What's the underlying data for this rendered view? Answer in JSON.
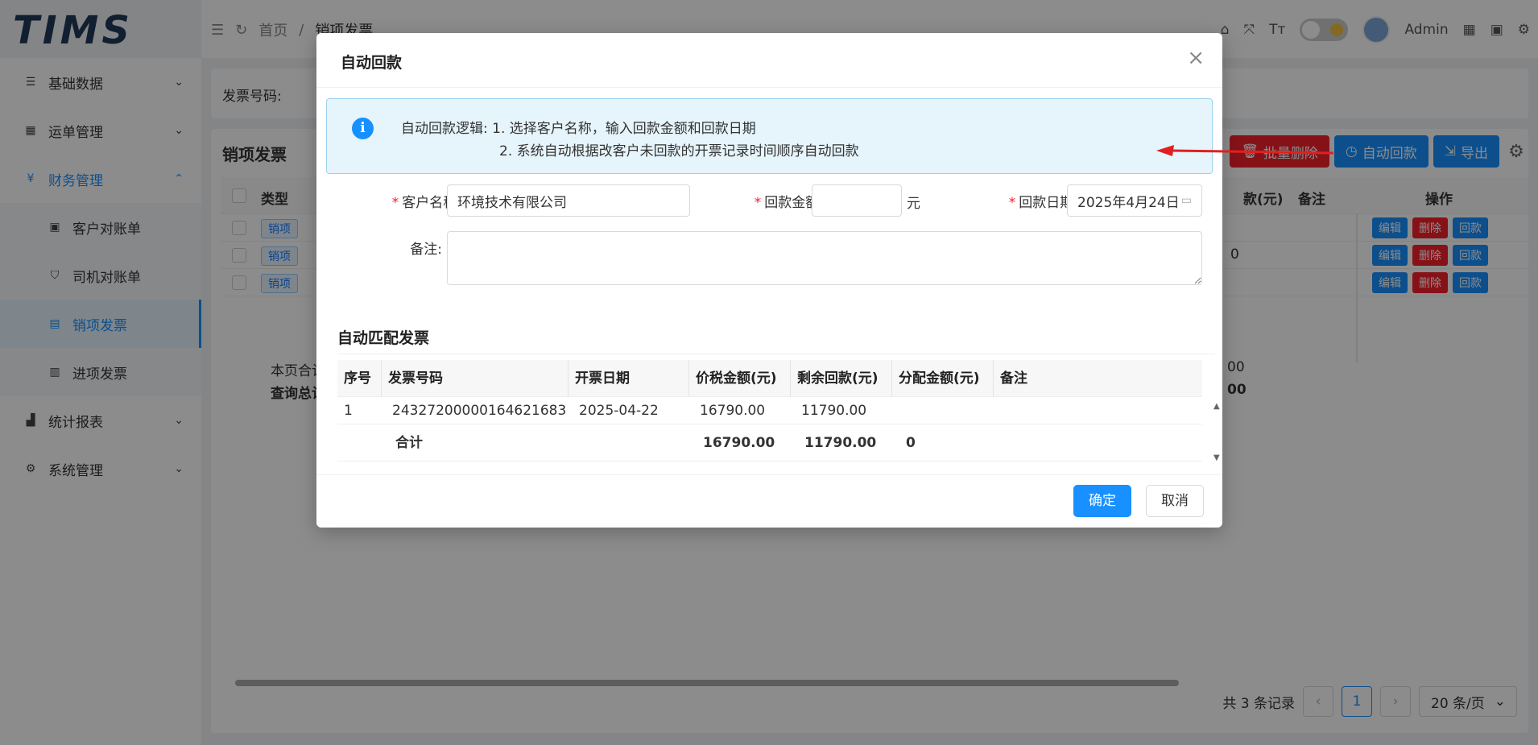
{
  "app": {
    "logo": "TIMS",
    "breadcrumb": [
      "首页",
      "/",
      "销项发票"
    ],
    "user": "Admin",
    "sidebar": [
      {
        "label": "基础数据",
        "icon": "list-icon"
      },
      {
        "label": "运单管理",
        "icon": "grid-icon"
      },
      {
        "label": "财务管理",
        "icon": "yen-icon"
      },
      {
        "label": "客户对账单",
        "icon": "bill-icon"
      },
      {
        "label": "司机对账单",
        "icon": "shield-icon"
      },
      {
        "label": "销项发票",
        "icon": "file-icon"
      },
      {
        "label": "进项发票",
        "icon": "file-search-icon"
      },
      {
        "label": "统计报表",
        "icon": "chart-icon"
      },
      {
        "label": "系统管理",
        "icon": "gear-icon"
      }
    ],
    "search_label": "发票号码:",
    "list_title": "销项发票",
    "toolbar": {
      "batch_delete": "批量删除",
      "auto_payment": "自动回款",
      "export": "导出"
    },
    "columns": {
      "type": "类型",
      "payment": "款(元)",
      "remark": "备注",
      "actions": "操作"
    },
    "rows": [
      {
        "tag": "销项",
        "payment": ""
      },
      {
        "tag": "销项",
        "payment": "0"
      },
      {
        "tag": "销项",
        "payment": ""
      }
    ],
    "row_actions": {
      "edit": "编辑",
      "delete": "删除",
      "payment": "回款"
    },
    "summary": {
      "page_total": "本页合计",
      "query_total": "查询总计",
      "page_val": "00",
      "query_val": "00"
    },
    "pagination": {
      "total": "共 3 条记录",
      "current": "1",
      "page_size": "20 条/页"
    }
  },
  "modal": {
    "title": "自动回款",
    "alert": {
      "line1": "自动回款逻辑: 1. 选择客户名称，输入回款金额和回款日期",
      "line2": "2. 系统自动根据改客户未回款的开票记录时间顺序自动回款"
    },
    "form": {
      "customer_label": "客户名称:",
      "customer_value": "环境技术有限公司",
      "amount_label": "回款金额:",
      "amount_value": "",
      "amount_unit": "元",
      "date_label": "回款日期:",
      "date_value": "2025年4月24日",
      "remark_label": "备注:",
      "remark_value": ""
    },
    "section_title": "自动匹配发票",
    "table": {
      "headers": [
        "序号",
        "发票号码",
        "开票日期",
        "价税金额(元)",
        "剩余回款(元)",
        "分配金额(元)",
        "备注"
      ],
      "rows": [
        [
          "1",
          "24327200000164621683",
          "2025-04-22",
          "16790.00",
          "11790.00",
          "",
          ""
        ]
      ],
      "sum": [
        "",
        "合计",
        "",
        "16790.00",
        "11790.00",
        "0",
        ""
      ]
    },
    "buttons": {
      "ok": "确定",
      "cancel": "取消"
    }
  }
}
